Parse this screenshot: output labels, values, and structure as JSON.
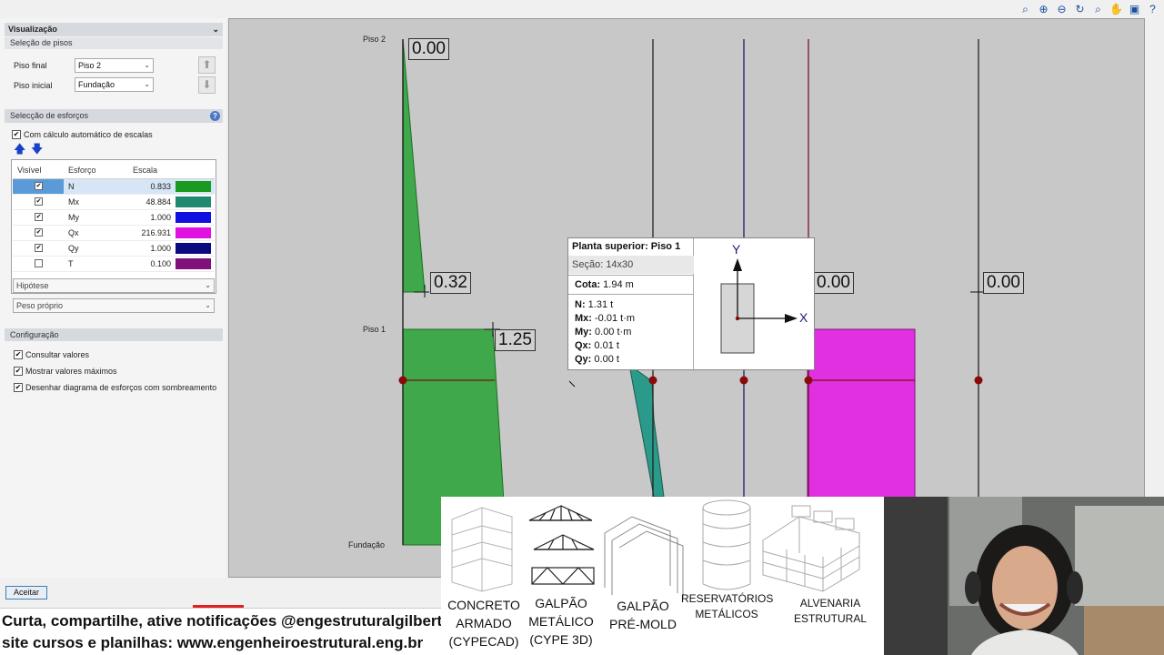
{
  "panel": {
    "visualizacao": "Visualização",
    "selecao_pisos": "Seleção de pisos",
    "piso_final_label": "Piso final",
    "piso_final_value": "Piso 2",
    "piso_inicial_label": "Piso inicial",
    "piso_inicial_value": "Fundação",
    "selecao_esforcos": "Selecção de esforços",
    "auto_scale": "Com cálculo automático de escalas",
    "table_headers": {
      "visible": "Visível",
      "effort": "Esforço",
      "scale": "Escala"
    },
    "rows": [
      {
        "name": "N",
        "scale": "0.833",
        "checked": "✔",
        "color": "#1a9a20"
      },
      {
        "name": "Mx",
        "scale": "48.884",
        "checked": "✔",
        "color": "#1e8a6e"
      },
      {
        "name": "My",
        "scale": "1.000",
        "checked": "✔",
        "color": "#1010e0"
      },
      {
        "name": "Qx",
        "scale": "216.931",
        "checked": "✔",
        "color": "#e010e0"
      },
      {
        "name": "Qy",
        "scale": "1.000",
        "checked": "✔",
        "color": "#0a0a80"
      },
      {
        "name": "T",
        "scale": "0.100",
        "checked": "",
        "color": "#80107a"
      }
    ],
    "hipotese": "Hipótese",
    "peso_proprio": "Peso próprio",
    "configuracao": "Configuração",
    "consultar": "Consultar valores",
    "mostrar": "Mostrar valores máximos",
    "desenhar": "Desenhar diagrama de esforços com sombreamento",
    "aceitar": "Aceitar"
  },
  "toolbar": [
    "zoom-window-icon",
    "zoom-in-icon",
    "zoom-out-icon",
    "refresh-icon",
    "zoom-all-icon",
    "pan-icon",
    "window-icon",
    "help-icon"
  ],
  "canvas": {
    "floors": {
      "piso2": "Piso 2",
      "piso1": "Piso 1",
      "fundacao": "Fundação"
    },
    "values": {
      "top": "0.00",
      "mid": "0.32",
      "n_piso1": "1.25",
      "right1": "0.00",
      "right2": "0.00"
    }
  },
  "tooltip": {
    "title": "Planta superior: Piso 1",
    "secao_label": "Seção:",
    "secao": "14x30",
    "cota_label": "Cota:",
    "cota": "1.94 m",
    "lines": [
      {
        "label": "N:",
        "value": "1.31 t"
      },
      {
        "label": "Mx:",
        "value": "-0.01 t·m"
      },
      {
        "label": "My:",
        "value": "0.00 t·m"
      },
      {
        "label": "Qx:",
        "value": "0.01 t"
      },
      {
        "label": "Qy:",
        "value": "0.00 t"
      }
    ],
    "axis_y": "Y",
    "axis_x": "X"
  },
  "banner": {
    "line1": "Curta, compartilhe, ative notificações @engestruturalgilberto",
    "line2": "site cursos e planilhas: www.engenheiroestrutural.eng.br"
  },
  "logos": [
    {
      "l1": "CONCRETO",
      "l2": "ARMADO",
      "l3": "(CYPECAD)"
    },
    {
      "l1": "GALPÃO",
      "l2": "METÁLICO",
      "l3": "(CYPE 3D)"
    },
    {
      "l1": "GALPÃO",
      "l2": "PRÉ-MOLD",
      "l3": ""
    },
    {
      "l1": "RESERVATÓRIOS",
      "l2": "METÁLICOS",
      "l3": ""
    },
    {
      "l1": "ALVENARIA",
      "l2": "ESTRUTURAL",
      "l3": ""
    }
  ]
}
